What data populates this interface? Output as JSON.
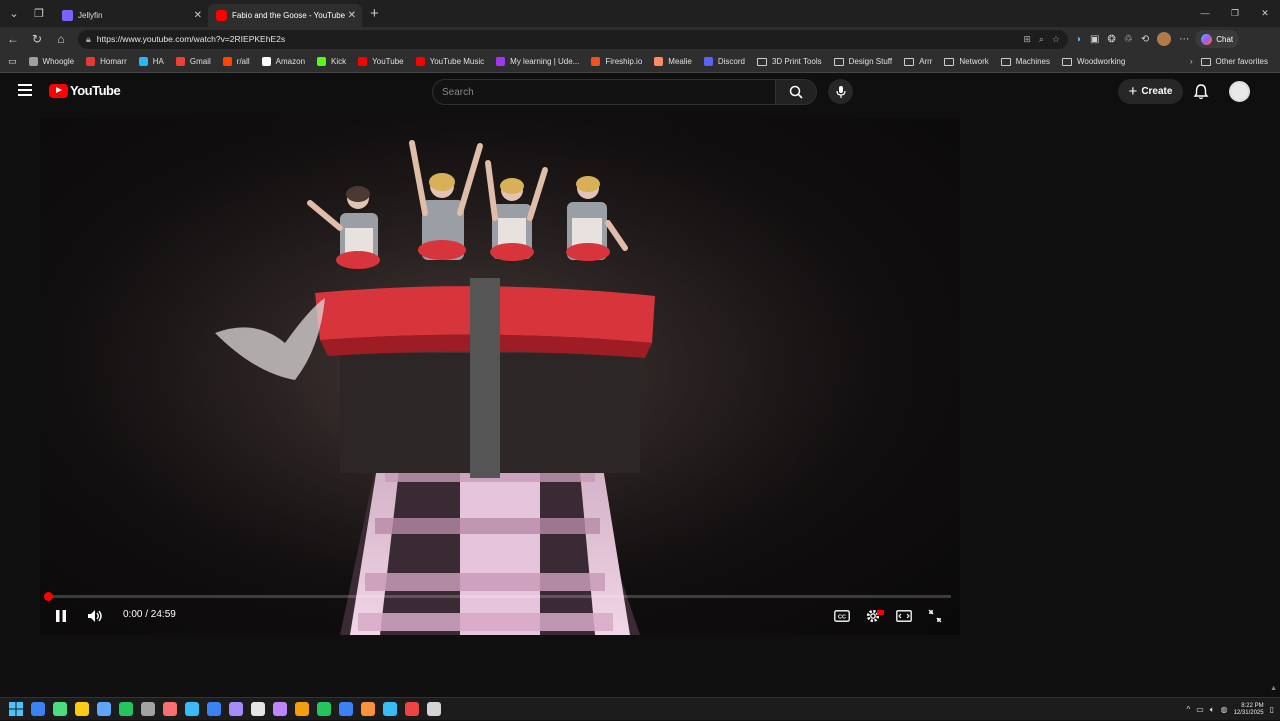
{
  "browser": {
    "tabs": [
      {
        "title": "Jellyfin",
        "color": "#7b61ff"
      },
      {
        "title": "Fabio and the Goose - YouTube",
        "color": "#ff0000"
      }
    ],
    "url": "https://www.youtube.com/watch?v=2RIEPKEhE2s",
    "copilot_label": "Chat"
  },
  "favorites": [
    {
      "label": "Whoogle",
      "color": "#9aa0a6",
      "type": "link"
    },
    {
      "label": "Homarr",
      "color": "#e53935",
      "type": "link"
    },
    {
      "label": "HA",
      "color": "#29b6f6",
      "type": "link"
    },
    {
      "label": "Gmail",
      "color": "#ea4335",
      "type": "link"
    },
    {
      "label": "r/all",
      "color": "#ff4500",
      "type": "link"
    },
    {
      "label": "Amazon",
      "color": "#ffffff",
      "type": "link"
    },
    {
      "label": "Kick",
      "color": "#53fc18",
      "type": "link"
    },
    {
      "label": "YouTube",
      "color": "#ff0000",
      "type": "link"
    },
    {
      "label": "YouTube Music",
      "color": "#ff0000",
      "type": "link"
    },
    {
      "label": "My learning | Ude...",
      "color": "#a435f0",
      "type": "link"
    },
    {
      "label": "Fireship.io",
      "color": "#f4511e",
      "type": "link"
    },
    {
      "label": "Mealie",
      "color": "#ff8a65",
      "type": "link"
    },
    {
      "label": "Discord",
      "color": "#5865f2",
      "type": "link"
    },
    {
      "label": "3D Print Tools",
      "color": "",
      "type": "folder"
    },
    {
      "label": "Design Stuff",
      "color": "",
      "type": "folder"
    },
    {
      "label": "Arrr",
      "color": "",
      "type": "folder"
    },
    {
      "label": "Network",
      "color": "",
      "type": "folder"
    },
    {
      "label": "Machines",
      "color": "",
      "type": "folder"
    },
    {
      "label": "Woodworking",
      "color": "",
      "type": "folder"
    }
  ],
  "other_favorites": "Other favorites",
  "youtube": {
    "logo_text": "YouTube",
    "search_placeholder": "Search",
    "create_label": "Create"
  },
  "player": {
    "current_time": "0:00",
    "duration": "24:59",
    "time_display": "0:00 / 24:59",
    "progress": 0,
    "state": "playing"
  },
  "taskbar": {
    "time": "8:22 PM",
    "date": "12/31/2025",
    "apps": [
      "#3b82f6",
      "#4ade80",
      "#facc15",
      "#60a5fa",
      "#22c55e",
      "#a3a3a3",
      "#f87171",
      "#38bdf8",
      "#3b82f6",
      "#a78bfa",
      "#e5e5e5",
      "#c084fc",
      "#f59e0b",
      "#22c55e",
      "#3b82f6",
      "#fb923c",
      "#38bdf8",
      "#ef4444",
      "#d4d4d4"
    ]
  }
}
